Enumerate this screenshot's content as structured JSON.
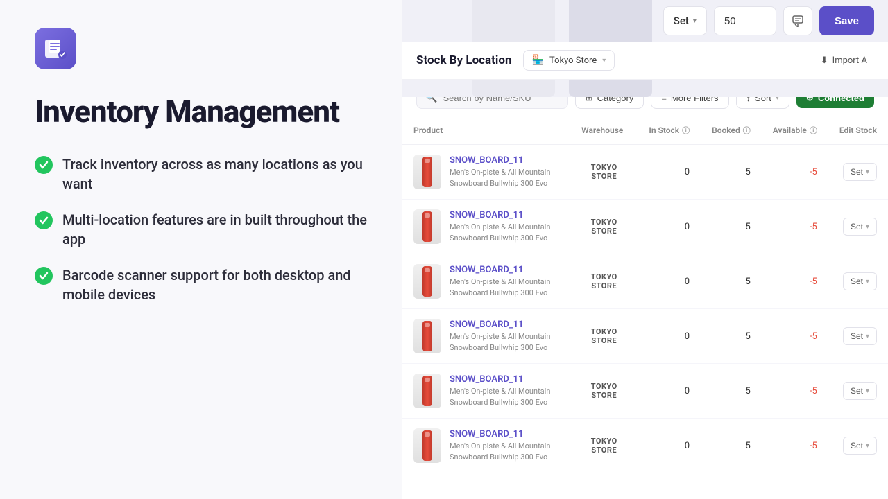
{
  "app": {
    "title": "Inventory Management"
  },
  "left": {
    "title": "Inventory Management",
    "features": [
      {
        "id": "f1",
        "text": "Track inventory across as many locations as you want"
      },
      {
        "id": "f2",
        "text": "Multi-location features are in built throughout the app"
      },
      {
        "id": "f3",
        "text": "Barcode scanner support for both desktop and mobile devices"
      }
    ]
  },
  "toolbar": {
    "set_label": "Set",
    "quantity_value": "50",
    "save_label": "Save"
  },
  "stock_header": {
    "title": "Stock By Location",
    "location": "Tokyo Store",
    "import_label": "Import A"
  },
  "filters": {
    "search_placeholder": "Search by Name/SKU",
    "category_label": "Category",
    "more_filters_label": "More Filters",
    "sort_label": "Sort",
    "connected_label": "Connected"
  },
  "table": {
    "columns": [
      {
        "id": "product",
        "label": "Product"
      },
      {
        "id": "warehouse",
        "label": "Warehouse"
      },
      {
        "id": "in_stock",
        "label": "In Stock"
      },
      {
        "id": "booked",
        "label": "Booked"
      },
      {
        "id": "available",
        "label": "Available"
      },
      {
        "id": "edit_stock",
        "label": "Edit Stock"
      }
    ],
    "rows": [
      {
        "id": "r1",
        "sku": "SNOW_BOARD_11",
        "description": "Men's On-piste & All Mountain Snowboard Bullwhip 300 Evo",
        "warehouse": "TOKYO\nSTORE",
        "in_stock": 0,
        "booked": 5,
        "available": -5,
        "action": "Set"
      },
      {
        "id": "r2",
        "sku": "SNOW_BOARD_11",
        "description": "Men's On-piste & All Mountain Snowboard Bullwhip 300 Evo",
        "warehouse": "TOKYO\nSTORE",
        "in_stock": 0,
        "booked": 5,
        "available": -5,
        "action": "Set"
      },
      {
        "id": "r3",
        "sku": "SNOW_BOARD_11",
        "description": "Men's On-piste & All Mountain Snowboard Bullwhip 300 Evo",
        "warehouse": "TOKYO\nSTORE",
        "in_stock": 0,
        "booked": 5,
        "available": -5,
        "action": "Set"
      },
      {
        "id": "r4",
        "sku": "SNOW_BOARD_11",
        "description": "Men's On-piste & All Mountain Snowboard Bullwhip 300 Evo",
        "warehouse": "TOKYO\nSTORE",
        "in_stock": 0,
        "booked": 5,
        "available": -5,
        "action": "Set"
      },
      {
        "id": "r5",
        "sku": "SNOW_BOARD_11",
        "description": "Men's On-piste & All Mountain Snowboard Bullwhip 300 Evo",
        "warehouse": "TOKYO\nSTORE",
        "in_stock": 0,
        "booked": 5,
        "available": -5,
        "action": "Set"
      },
      {
        "id": "r6",
        "sku": "SNOW_BOARD_11",
        "description": "Men's On-piste & All Mountain Snowboard Bullwhip 300 Evo",
        "warehouse": "TOKYO\nSTORE",
        "in_stock": 0,
        "booked": 5,
        "available": -5,
        "action": "Set"
      }
    ]
  }
}
